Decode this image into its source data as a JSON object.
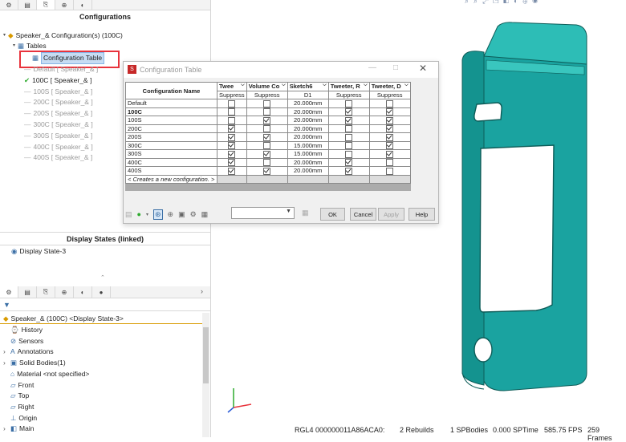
{
  "configurations_panel": {
    "title": "Configurations",
    "root": "Speaker_& Configuration(s)  (100C)",
    "tables": "Tables",
    "config_table": "Configuration Table",
    "items": [
      {
        "label": "Default [ Speaker_& ]",
        "state": "grey"
      },
      {
        "label": "100C [ Speaker_& ]",
        "state": "active"
      },
      {
        "label": "100S [ Speaker_& ]",
        "state": "grey"
      },
      {
        "label": "200C [ Speaker_& ]",
        "state": "grey"
      },
      {
        "label": "200S [ Speaker_& ]",
        "state": "grey"
      },
      {
        "label": "300C [ Speaker_& ]",
        "state": "grey"
      },
      {
        "label": "300S [ Speaker_& ]",
        "state": "grey"
      },
      {
        "label": "400C [ Speaker_& ]",
        "state": "grey"
      },
      {
        "label": "400S [ Speaker_& ]",
        "state": "grey"
      }
    ]
  },
  "display_states": {
    "title": "Display States (linked)",
    "item": "Display State-3"
  },
  "feature_tree": {
    "root": "Speaker_& (100C) <Display State-3>",
    "items": [
      "History",
      "Sensors",
      "Annotations",
      "Solid Bodies(1)",
      "Material <not specified>",
      "Front",
      "Top",
      "Right",
      "Origin",
      "Main"
    ]
  },
  "dialog": {
    "title": "Configuration Table",
    "corner_header": "Configuration Name",
    "columns": [
      {
        "name": "Twee",
        "sub": "Suppress"
      },
      {
        "name": "Volume Co",
        "sub": "Suppress"
      },
      {
        "name": "Sketch6",
        "sub": "D1"
      },
      {
        "name": "Tweeter, R",
        "sub": "Suppress"
      },
      {
        "name": "Tweeter, D",
        "sub": "Suppress"
      }
    ],
    "rows": [
      {
        "name": "Default",
        "bold": false,
        "c1": false,
        "c2": false,
        "d1": "20.000mm",
        "c4": false,
        "c5": false
      },
      {
        "name": "100C",
        "bold": true,
        "c1": false,
        "c2": false,
        "d1": "20.000mm",
        "c4": true,
        "c5": true
      },
      {
        "name": "100S",
        "bold": false,
        "c1": false,
        "c2": true,
        "d1": "20.000mm",
        "c4": true,
        "c5": true
      },
      {
        "name": "200C",
        "bold": false,
        "c1": true,
        "c2": false,
        "d1": "20.000mm",
        "c4": false,
        "c5": true
      },
      {
        "name": "200S",
        "bold": false,
        "c1": true,
        "c2": true,
        "d1": "20.000mm",
        "c4": false,
        "c5": true
      },
      {
        "name": "300C",
        "bold": false,
        "c1": true,
        "c2": false,
        "d1": "15.000mm",
        "c4": false,
        "c5": true
      },
      {
        "name": "300S",
        "bold": false,
        "c1": true,
        "c2": true,
        "d1": "15.000mm",
        "c4": false,
        "c5": true
      },
      {
        "name": "400C",
        "bold": false,
        "c1": true,
        "c2": false,
        "d1": "20.000mm",
        "c4": true,
        "c5": false
      },
      {
        "name": "400S",
        "bold": false,
        "c1": true,
        "c2": true,
        "d1": "20.000mm",
        "c4": true,
        "c5": false
      }
    ],
    "new_row": "< Creates a new configuration. >",
    "ok": "OK",
    "cancel": "Cancel",
    "apply": "Apply",
    "help": "Help"
  },
  "status_bar": {
    "rgl": "RGL4 000000011A86ACA0:",
    "rebuilds": "2 Rebuilds",
    "spbodies": "1 SPBodies",
    "sptime": "0.000 SPTime",
    "fps": "585.75 FPS",
    "frames": "259 Frames"
  },
  "colors": {
    "model": "#1aa3a0",
    "highlight": "#e8333c",
    "selection": "#c6dcf3"
  }
}
